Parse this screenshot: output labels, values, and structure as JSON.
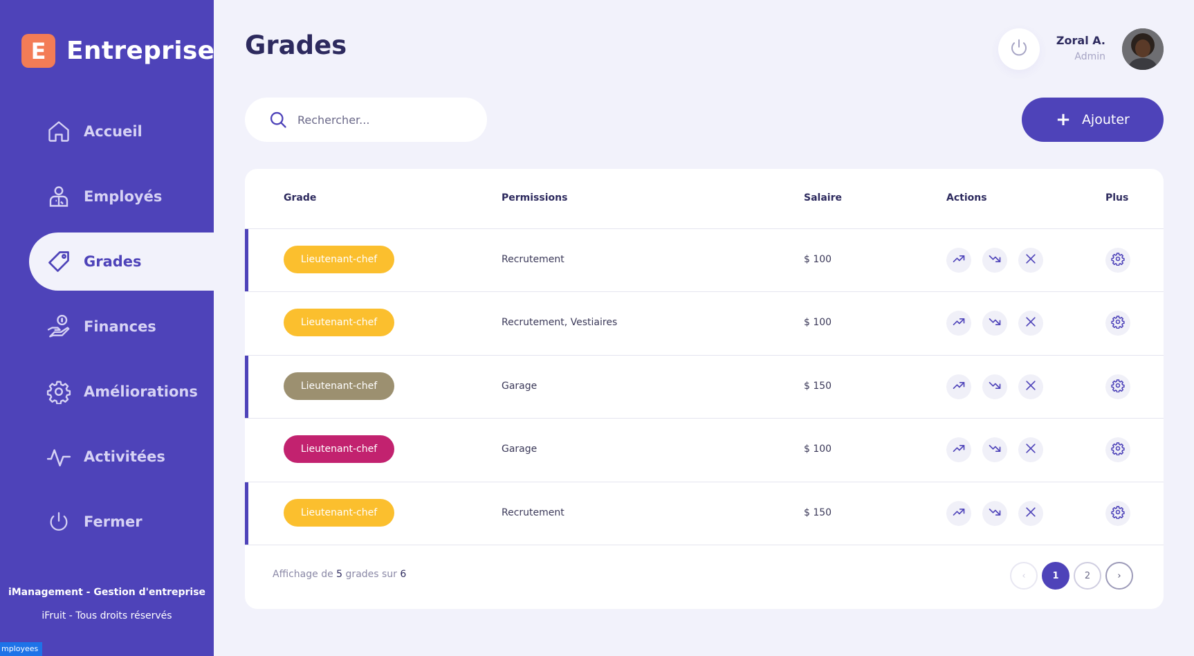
{
  "brand": {
    "logo_letter": "E",
    "name": "Entreprise"
  },
  "nav": [
    {
      "label": "Accueil",
      "icon": "home-icon",
      "active": false
    },
    {
      "label": "Employés",
      "icon": "user-icon",
      "active": false
    },
    {
      "label": "Grades",
      "icon": "tag-icon",
      "active": true
    },
    {
      "label": "Finances",
      "icon": "hand-coin-icon",
      "active": false
    },
    {
      "label": "Améliorations",
      "icon": "gear-icon",
      "active": false
    },
    {
      "label": "Activitées",
      "icon": "activity-icon",
      "active": false
    },
    {
      "label": "Fermer",
      "icon": "power-icon",
      "active": false
    }
  ],
  "sidebar_footer": {
    "title": "iManagement - Gestion d'entreprise",
    "subtitle": "iFruit - Tous droits réservés"
  },
  "tooltip_tag": "mployees",
  "header": {
    "title": "Grades",
    "user": {
      "name": "Zoral A.",
      "role": "Admin"
    }
  },
  "search": {
    "placeholder": "Rechercher...",
    "value": ""
  },
  "add_button": {
    "label": "Ajouter"
  },
  "table": {
    "columns": [
      "Grade",
      "Permissions",
      "Salaire",
      "Actions",
      "Plus"
    ],
    "rows": [
      {
        "grade": "Lieutenant-chef",
        "color": "#fbbf2e",
        "permissions": "Recrutement",
        "salary": "$ 100",
        "marked": true
      },
      {
        "grade": "Lieutenant-chef",
        "color": "#fbbf2e",
        "permissions": "Recrutement, Vestiaires",
        "salary": "$ 100",
        "marked": false
      },
      {
        "grade": "Lieutenant-chef",
        "color": "#9c9070",
        "permissions": "Garage",
        "salary": "$ 150",
        "marked": true
      },
      {
        "grade": "Lieutenant-chef",
        "color": "#c2226f",
        "permissions": "Garage",
        "salary": "$ 100",
        "marked": false
      },
      {
        "grade": "Lieutenant-chef",
        "color": "#fbbf2e",
        "permissions": "Recrutement",
        "salary": "$ 150",
        "marked": true
      }
    ]
  },
  "footer": {
    "prefix": "Affichage de",
    "shown": "5",
    "middle": "grades sur",
    "total": "6"
  },
  "pagination": {
    "prev": "‹",
    "pages": [
      "1",
      "2"
    ],
    "current": "1",
    "next": "›"
  },
  "colors": {
    "accent": "#4e43b9",
    "background": "#f2f2fb",
    "logo": "#f37c56"
  }
}
